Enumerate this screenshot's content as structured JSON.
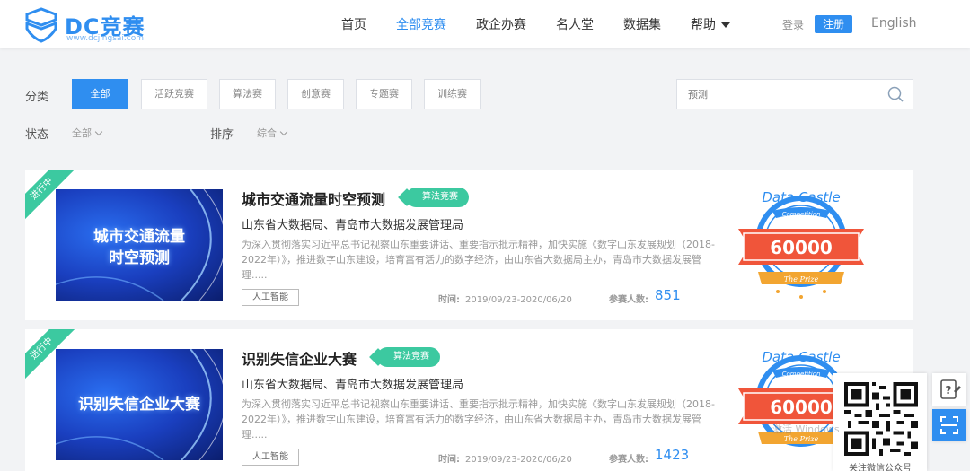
{
  "header": {
    "logo_text": "DC竞赛",
    "logo_sub": "www.dcjingsai.com",
    "nav": [
      "首页",
      "全部竞赛",
      "政企办赛",
      "名人堂",
      "数据集",
      "帮助"
    ],
    "active_nav": "全部竞赛",
    "login": "登录",
    "register": "注册",
    "language": "English"
  },
  "filters": {
    "category_label": "分类",
    "categories": [
      "全部",
      "活跃竞赛",
      "算法赛",
      "创意赛",
      "专题赛",
      "训练赛"
    ],
    "active_category": "全部",
    "status_label": "状态",
    "status_value": "全部",
    "sort_label": "排序",
    "sort_value": "综合",
    "search_placeholder": "预测"
  },
  "competitions": [
    {
      "status": "进行中",
      "thumb_lines": [
        "城市交通流量",
        "时空预测"
      ],
      "title": "城市交通流量时空预测",
      "type_tag": "算法竞赛",
      "organizer": "山东省大数据局、青岛市大数据发展管理局",
      "description": "为深入贯彻落实习近平总书记视察山东重要讲话、重要指示批示精神，加快实施《数字山东发展规划（2018-2022年）》，推进数字山东建设，培育富有活力的数字经济，由山东省大数据局主办，青岛市大数据发展管理.....",
      "field": "人工智能",
      "time_label": "时间:",
      "time": "2019/09/23-2020/06/20",
      "participants_label": "参赛人数:",
      "participants": "851",
      "badge_title": "Data Castle",
      "badge_sub": "Competition",
      "prize": "60000",
      "badge_ribbon": "The Prize"
    },
    {
      "status": "进行中",
      "thumb_lines": [
        "识别失信企业大赛"
      ],
      "title": "识别失信企业大赛",
      "type_tag": "算法竞赛",
      "organizer": "山东省大数据局、青岛市大数据发展管理局",
      "description": "为深入贯彻落实习近平总书记视察山东重要讲话、重要指示批示精神，加快实施《数字山东发展规划（2018-2022年）》，推进数字山东建设，培育富有活力的数字经济，由山东省大数据局主办，青岛市大数据发展管理.....",
      "field": "人工智能",
      "time_label": "时间:",
      "time": "2019/09/23-2020/06/20",
      "participants_label": "参赛人数:",
      "participants": "1423",
      "badge_title": "Data Castle",
      "badge_sub": "Competition",
      "prize": "60000",
      "badge_ribbon": "The Prize"
    }
  ],
  "floating": {
    "qr_caption": "关注微信公众号",
    "watermark": "激活 Windows"
  },
  "colors": {
    "primary": "#2f8ef0",
    "tag_green": "#3cc9a0",
    "badge_red": "#f0553a",
    "badge_blue": "#2f8ef0"
  }
}
